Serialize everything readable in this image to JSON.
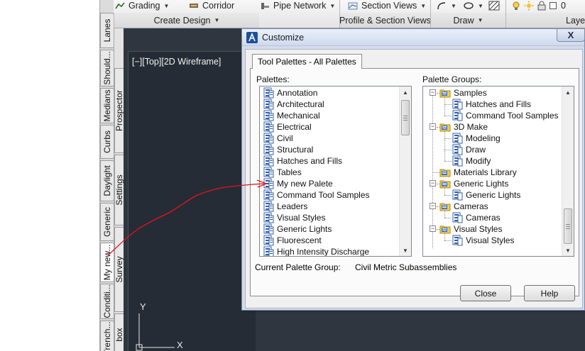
{
  "ribbon": {
    "tools": [
      {
        "label": "Grading",
        "icon": "grading-icon"
      },
      {
        "label": "Corridor",
        "icon": "corridor-icon"
      },
      {
        "label": "Pipe Network",
        "icon": "pipe-network-icon"
      },
      {
        "label": "Section Views",
        "icon": "section-views-icon"
      },
      {
        "label": "0",
        "icon": "layer-number"
      }
    ],
    "panels": {
      "create_design": "Create Design",
      "profile_section_views": "Profile & Section Views",
      "draw": "Draw",
      "layers": "Layer"
    }
  },
  "palette_tabs": {
    "left": [
      "Lanes",
      "Should...",
      "Medians",
      "Curbs",
      "Daylight",
      "Generic",
      "My new...",
      "Conditi...",
      "Trench..."
    ],
    "right": [
      "Prospector",
      "Settings",
      "Survey",
      "box"
    ]
  },
  "viewport": {
    "label": "[−][Top][2D Wireframe]",
    "ucs_y": "Y",
    "ucs_x": "X"
  },
  "dialog": {
    "title": "Customize",
    "close_glyph": "X",
    "tab_label": "Tool Palettes - All Palettes",
    "palettes_label": "Palettes:",
    "palettes": [
      "Annotation",
      "Architectural",
      "Mechanical",
      "Electrical",
      "Civil",
      "Structural",
      "Hatches and Fills",
      "Tables",
      "My new Palete",
      "Command Tool Samples",
      "Leaders",
      "Visual Styles",
      "Generic Lights",
      "Fluorescent",
      "High Intensity Discharge"
    ],
    "palette_groups_label": "Palette Groups:",
    "palette_groups": [
      {
        "label": "Samples",
        "level": 0
      },
      {
        "label": "Hatches and Fills",
        "level": 1
      },
      {
        "label": "Command Tool Samples",
        "level": 1
      },
      {
        "label": "3D Make",
        "level": 0
      },
      {
        "label": "Modeling",
        "level": 1
      },
      {
        "label": "Draw",
        "level": 1
      },
      {
        "label": "Modify",
        "level": 1
      },
      {
        "label": "Materials Library",
        "level": 0
      },
      {
        "label": "Generic Lights",
        "level": 0
      },
      {
        "label": "Generic Lights",
        "level": 1
      },
      {
        "label": "Cameras",
        "level": 0
      },
      {
        "label": "Cameras",
        "level": 1
      },
      {
        "label": "Visual Styles",
        "level": 0
      },
      {
        "label": "Visual Styles",
        "level": 1
      }
    ],
    "current_group_label": "Current Palette Group:",
    "current_group_value": "Civil Metric Subassemblies",
    "close_button": "Close",
    "help_button": "Help"
  },
  "colors": {
    "viewport_bg": "#2f3640",
    "dialog_frame": "#d6dbe9",
    "annotation_red": "#e0141e",
    "folder_yellow": "#f2c94c",
    "palette_blue": "#2b5fb3"
  }
}
